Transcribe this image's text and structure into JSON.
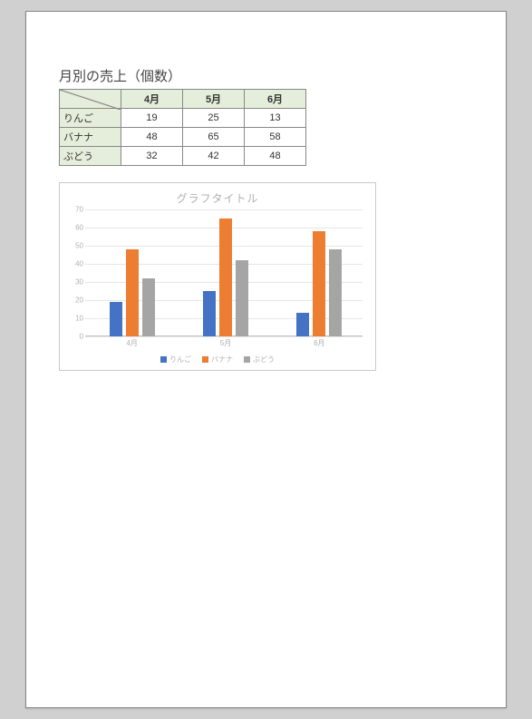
{
  "table": {
    "title": "月別の売上（個数）",
    "columns": [
      "4月",
      "5月",
      "6月"
    ],
    "rows": [
      {
        "label": "りんご",
        "values": [
          19,
          25,
          13
        ]
      },
      {
        "label": "バナナ",
        "values": [
          48,
          65,
          58
        ]
      },
      {
        "label": "ぶどう",
        "values": [
          32,
          42,
          48
        ]
      }
    ]
  },
  "chart_title": "グラフタイトル",
  "chart_data": {
    "type": "bar",
    "title": "グラフタイトル",
    "categories": [
      "4月",
      "5月",
      "6月"
    ],
    "series": [
      {
        "name": "りんご",
        "values": [
          19,
          25,
          13
        ],
        "color": "#4472c4"
      },
      {
        "name": "バナナ",
        "values": [
          48,
          65,
          58
        ],
        "color": "#ed7d31"
      },
      {
        "name": "ぶどう",
        "values": [
          32,
          42,
          48
        ],
        "color": "#a5a5a5"
      }
    ],
    "ylim": [
      0,
      70
    ],
    "yticks": [
      0,
      10,
      20,
      30,
      40,
      50,
      60,
      70
    ],
    "xlabel": "",
    "ylabel": ""
  }
}
